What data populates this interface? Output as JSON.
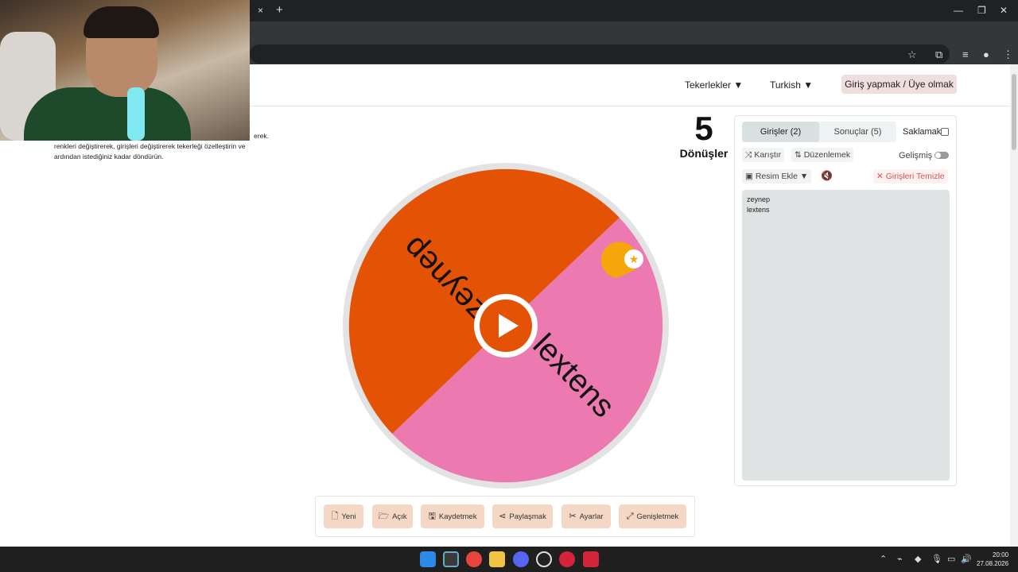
{
  "browser": {
    "tab_close": "×",
    "new_tab": "+",
    "win_min": "—",
    "win_max": "❐",
    "win_close": "✕"
  },
  "header": {
    "nav_wheels": "Tekerlekler ▼",
    "nav_language": "Turkish ▼",
    "login_button": "Giriş yapmak / Üye olmak"
  },
  "description": {
    "line0": "erek.",
    "line1": "renkleri değiştirerek, girişleri değiştirerek tekerleği özelleştirin ve",
    "line2": "ardından istediğiniz kadar döndürün."
  },
  "spins": {
    "count": "5",
    "label": "Dönüşler"
  },
  "wheel": {
    "segments": [
      {
        "label": "zeynep",
        "color": "#e35205"
      },
      {
        "label": "lextens",
        "color": "#ec79b0"
      }
    ],
    "center_color": "#e35205",
    "pointer_color": "#f4a60a"
  },
  "panel": {
    "tab_entries": "Girişler (2)",
    "tab_results": "Sonuçlar (5)",
    "hide_label": "Saklamak",
    "shuffle": "Karıştır",
    "sort": "Düzenlemek",
    "advanced": "Gelişmiş",
    "add_image": "Resim Ekle ▼",
    "clear_entries": "Girişleri Temizle",
    "entries": [
      "zeynep",
      "lextens"
    ]
  },
  "toolbar": {
    "new": "Yeni",
    "open": "Açık",
    "save": "Kaydetmek",
    "share": "Paylaşmak",
    "settings": "Ayarlar",
    "expand": "Genişletmek"
  },
  "taskbar": {
    "time": "20:00",
    "date": "27.08.2026"
  }
}
